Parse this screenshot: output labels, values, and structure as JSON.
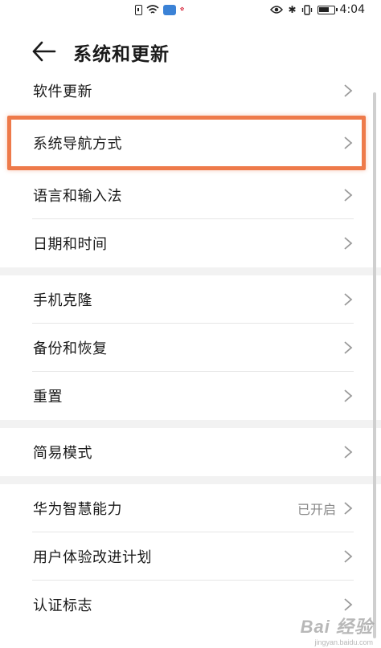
{
  "status_bar": {
    "time": "4:04",
    "icons": [
      "sim-icon",
      "wifi-icon",
      "cloud-icon",
      "huawei-logo",
      "eye-icon",
      "bluetooth-icon",
      "vibrate-icon",
      "battery-icon"
    ]
  },
  "header": {
    "title": "系统和更新",
    "back_icon": "arrow-left-icon"
  },
  "groups": [
    {
      "items": [
        {
          "label": "软件更新"
        },
        {
          "label": "系统导航方式",
          "highlighted": true
        },
        {
          "label": "语言和输入法"
        },
        {
          "label": "日期和时间"
        }
      ]
    },
    {
      "items": [
        {
          "label": "手机克隆"
        },
        {
          "label": "备份和恢复"
        },
        {
          "label": "重置"
        }
      ]
    },
    {
      "items": [
        {
          "label": "简易模式"
        }
      ]
    },
    {
      "items": [
        {
          "label": "华为智慧能力",
          "value": "已开启"
        },
        {
          "label": "用户体验改进计划"
        },
        {
          "label": "认证标志"
        }
      ]
    }
  ],
  "colors": {
    "highlight": "#ee7a4a",
    "divider": "#e6e6e6",
    "group_gap": "#f2f2f2",
    "value_text": "#888888"
  },
  "watermark": {
    "main": "Bai 经验",
    "sub": "jingyan.baidu.com"
  }
}
